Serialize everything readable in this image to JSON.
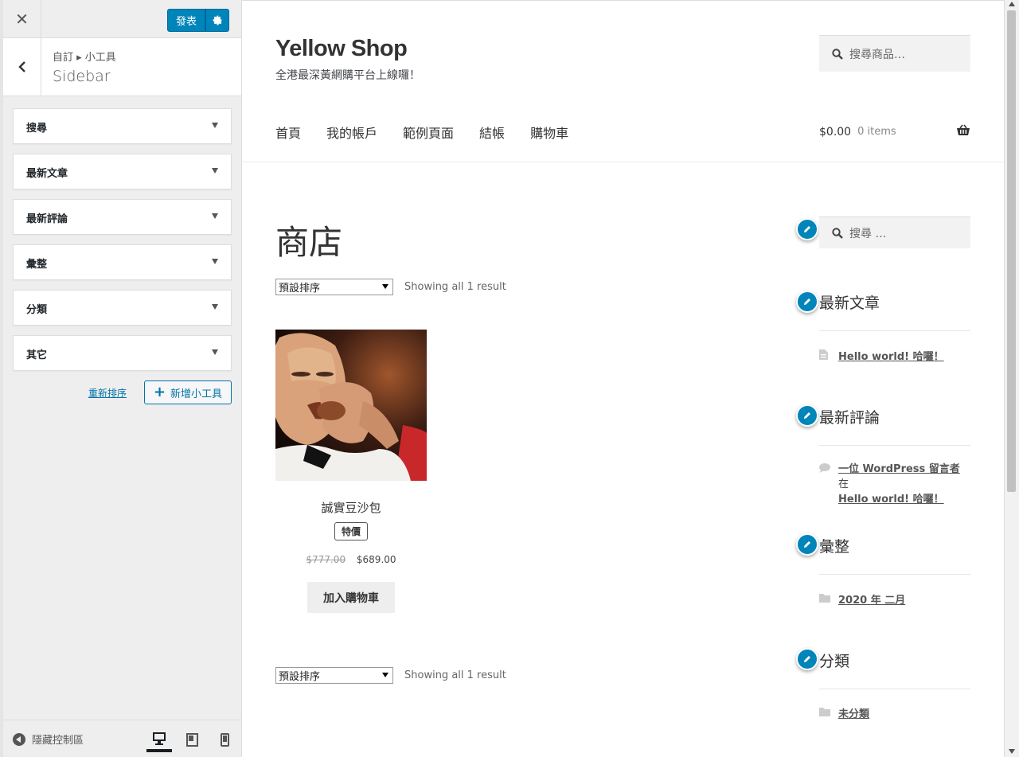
{
  "customizer": {
    "close_icon": "close-icon",
    "publish_label": "發表",
    "breadcrumb": "自訂 ▸ 小工具",
    "section_title": "Sidebar",
    "widgets": [
      {
        "label": "搜尋"
      },
      {
        "label": "最新文章"
      },
      {
        "label": "最新評論"
      },
      {
        "label": "彙整"
      },
      {
        "label": "分類"
      },
      {
        "label": "其它"
      }
    ],
    "reorder_label": "重新排序",
    "add_widget_label": "新增小工具",
    "hide_controls_label": "隱藏控制區",
    "devices": [
      "desktop-icon",
      "tablet-icon",
      "mobile-icon"
    ],
    "accent_color": "#0085ba"
  },
  "site": {
    "title": "Yellow Shop",
    "description": "全港最深黃網購平台上線囉！",
    "search_placeholder": "搜尋商品…",
    "nav": [
      "首頁",
      "我的帳戶",
      "範例頁面",
      "結帳",
      "購物車"
    ],
    "cart_total": "$0.00",
    "cart_items": "0 items"
  },
  "shop": {
    "page_title": "商店",
    "sort_selected": "預設排序",
    "result_count": "Showing all 1 result",
    "product": {
      "name": "誠實豆沙包",
      "badge": "特價",
      "old_price": "$777.00",
      "price": "$689.00",
      "add_to_cart": "加入購物車"
    }
  },
  "sidebar": {
    "search_placeholder": "搜尋 …",
    "recent_posts_heading": "最新文章",
    "recent_post": "Hello world! 哈囉！",
    "recent_comments_heading": "最新評論",
    "comment_author": "一位 WordPress 留言者",
    "comment_on": "在",
    "comment_post": "Hello world! 哈囉！",
    "archives_heading": "彙整",
    "archive_item": "2020 年 二月",
    "categories_heading": "分類",
    "category_item": "未分類"
  }
}
